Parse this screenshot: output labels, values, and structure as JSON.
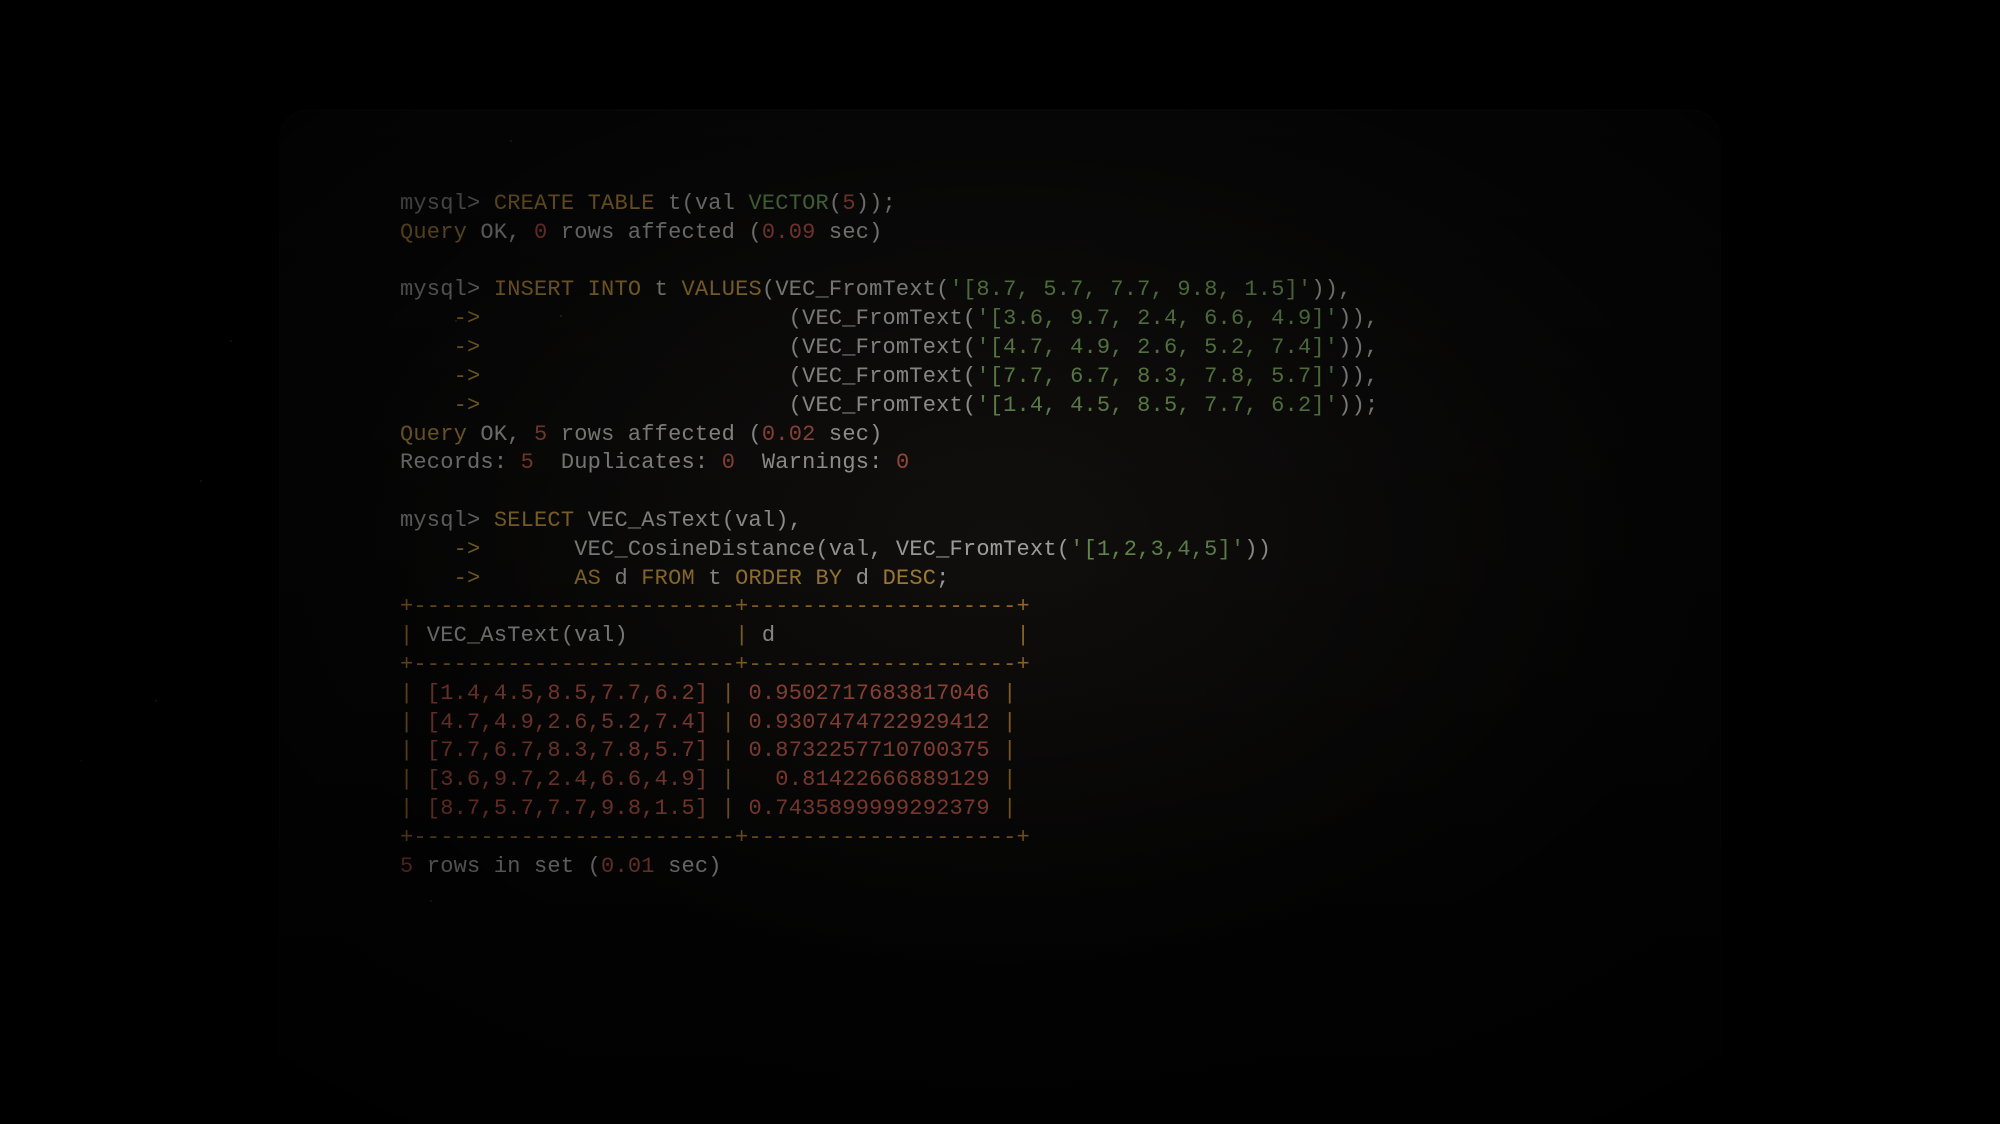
{
  "session": {
    "cmd1": {
      "prompt": "mysql>",
      "create_kw1": "CREATE",
      "create_kw2": "TABLE",
      "tbl": "t",
      "col_open": "(val",
      "vec_type": "VECTOR",
      "vec_arg_open": "(",
      "vec_arg_num": "5",
      "vec_arg_close": "));",
      "result_label": "Query",
      "result_ok": "OK",
      "result_comma": ",",
      "result_rows_n": "0",
      "result_rows_txt": "rows affected (",
      "result_time": "0.09",
      "result_sec": "sec)"
    },
    "cmd2": {
      "prompt": "mysql>",
      "insert_kw1": "INSERT",
      "insert_kw2": "INTO",
      "tbl": "t",
      "values_kw": "VALUES",
      "fn": "VEC_FromText",
      "arrow": "    ->",
      "rows": [
        "'[8.7, 5.7, 7.7, 9.8, 1.5]'",
        "'[3.6, 9.7, 2.4, 6.6, 4.9]'",
        "'[4.7, 4.9, 2.6, 5.2, 7.4]'",
        "'[7.7, 6.7, 8.3, 7.8, 5.7]'",
        "'[1.4, 4.5, 8.5, 7.7, 6.2]'"
      ],
      "result_label": "Query",
      "result_ok": "OK",
      "result_comma": ",",
      "result_rows_n": "5",
      "result_rows_txt": "rows affected (",
      "result_time": "0.02",
      "result_sec": "sec)",
      "records_lbl": "Records:",
      "records_n": "5",
      "dup_lbl": "Duplicates:",
      "dup_n": "0",
      "warn_lbl": "Warnings:",
      "warn_n": "0"
    },
    "cmd3": {
      "prompt": "mysql>",
      "select_kw": "SELECT",
      "fn_text": "VEC_AsText",
      "fn_arg": "(val),",
      "arrow": "    ->",
      "fn_cos": "VEC_CosineDistance",
      "cos_open": "(val,",
      "cos_fn": "VEC_FromText",
      "cos_fn_open": "(",
      "cos_fn_str": "'[1,2,3,4,5]'",
      "cos_fn_close": "))",
      "as_kw": "AS",
      "as_alias": "d",
      "from_kw": "FROM",
      "from_tbl": "t",
      "order_kw1": "ORDER",
      "order_kw2": "BY",
      "order_col": "d",
      "desc_kw": "DESC",
      "end": ";"
    },
    "table": {
      "border_top": "+------------------------+--------------------+",
      "header_pipe1": "|",
      "header_col1": " VEC_AsText(val)        ",
      "header_pipe2": "|",
      "header_col2": " d                  ",
      "header_pipe3": "|",
      "rows": [
        {
          "vec": "[1.4,4.5,8.5,7.7,6.2]",
          "d": "0.9502717683817046"
        },
        {
          "vec": "[4.7,4.9,2.6,5.2,7.4]",
          "d": "0.9307474722929412"
        },
        {
          "vec": "[7.7,6.7,8.3,7.8,5.7]",
          "d": "0.8732257710700375"
        },
        {
          "vec": "[3.6,9.7,2.4,6.6,4.9]",
          "d": "  0.81422666889129"
        },
        {
          "vec": "[8.7,5.7,7.7,9.8,1.5]",
          "d": "0.7435899999292379"
        }
      ]
    },
    "footer": {
      "rows_n": "5",
      "rows_txt": "rows in set (",
      "time": "0.01",
      "sec": "sec)"
    }
  }
}
